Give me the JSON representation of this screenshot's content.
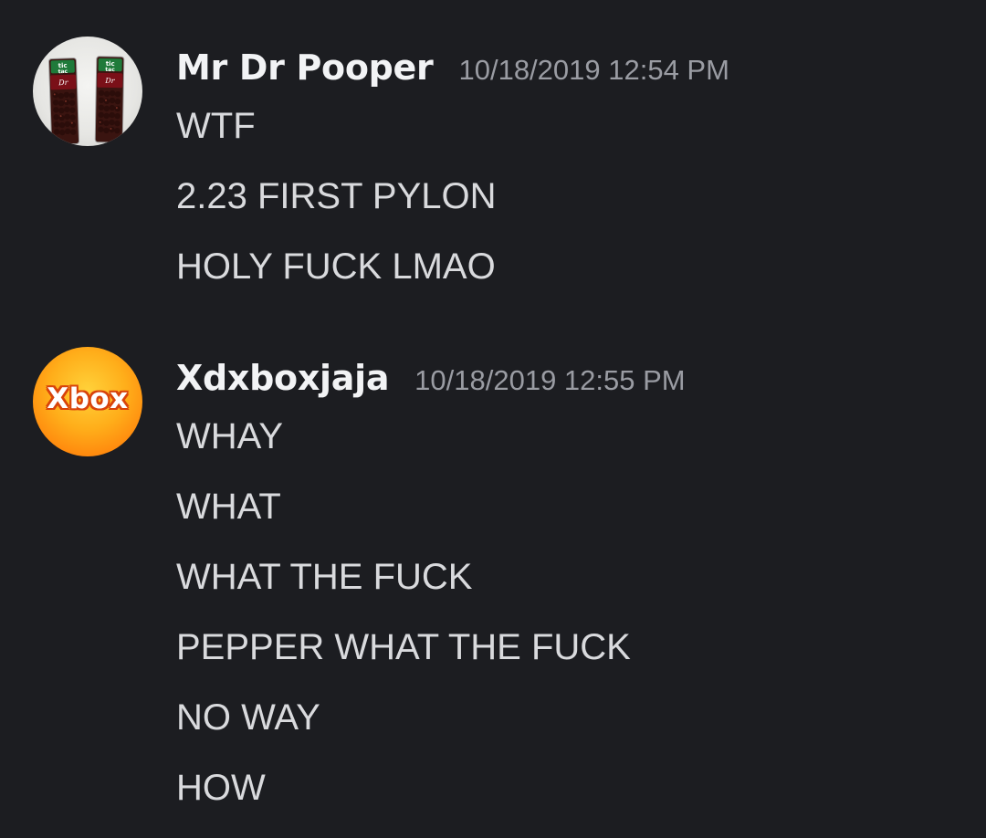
{
  "messages": [
    {
      "username": "Mr Dr Pooper",
      "timestamp": "10/18/2019 12:54 PM",
      "avatar": "tic-tac-dr-pepper-avatar",
      "lines": [
        "WTF",
        "2.23 FIRST PYLON",
        "HOLY FUCK LMAO"
      ]
    },
    {
      "username": "Xdxboxjaja",
      "timestamp": "10/18/2019 12:55 PM",
      "avatar_text": "Xbox",
      "avatar_colors": {
        "fill": "#ffae1a",
        "outline": "#d8430a"
      },
      "lines": [
        "WHAY",
        "WHAT",
        "WHAT THE FUCK",
        "PEPPER WHAT THE FUCK",
        "NO WAY",
        "HOW"
      ]
    }
  ],
  "colors": {
    "background": "#1c1d21",
    "username": "#f2f3f5",
    "timestamp": "#9a9ca3",
    "message_text": "#d9dadd"
  }
}
